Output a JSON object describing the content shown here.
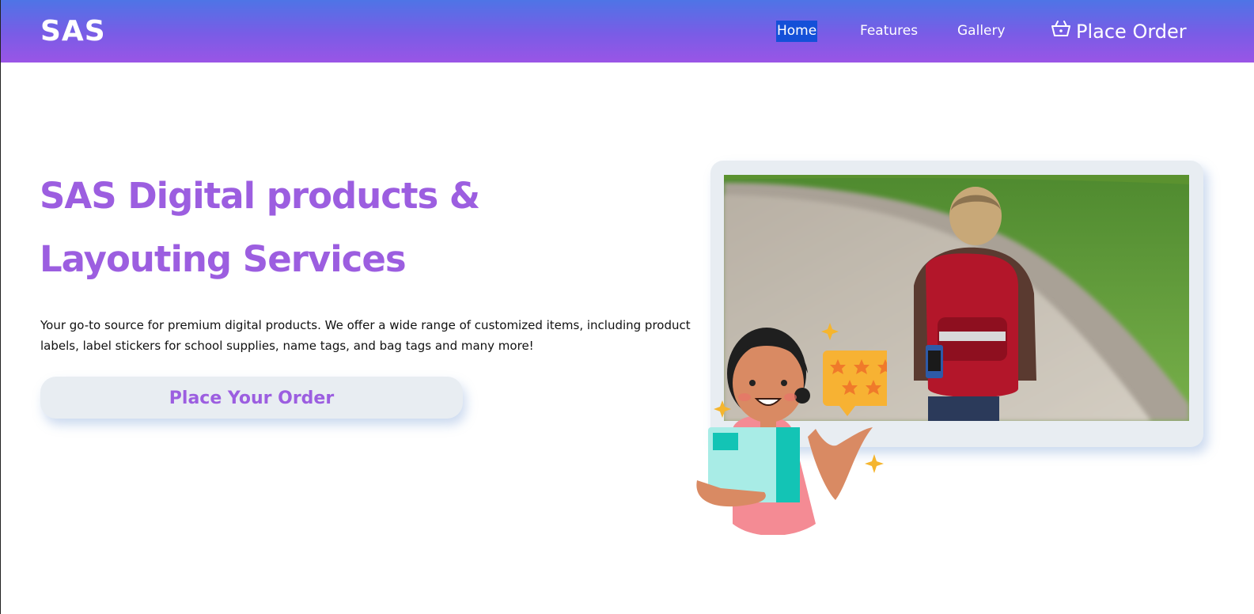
{
  "header": {
    "logo": "SAS",
    "nav": {
      "home": "Home",
      "features": "Features",
      "gallery": "Gallery",
      "place_order": "Place Order"
    }
  },
  "hero": {
    "title": "SAS Digital products & Layouting Services",
    "description": "Your go-to source for premium digital products. We offer a wide range of customized items, including product labels, label stickers for school supplies, name tags, and bag tags and many more!",
    "cta_label": "Place Your Order"
  },
  "icons": {
    "cart": "basket-icon"
  },
  "colors": {
    "header_gradient_start": "#4e74e6",
    "header_gradient_end": "#9a55e6",
    "accent_purple": "#9c5ee0",
    "card_background": "#e8edf2",
    "home_highlight": "#1450d8"
  }
}
